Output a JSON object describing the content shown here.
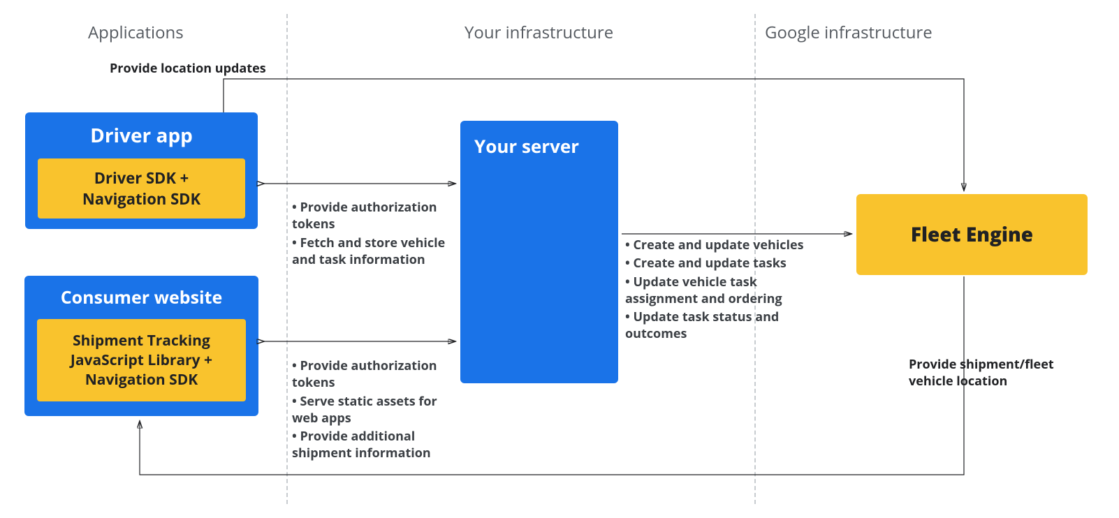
{
  "sections": {
    "applications": "Applications",
    "your_infra": "Your infrastructure",
    "google_infra": "Google infrastructure"
  },
  "driver_app": {
    "title": "Driver app",
    "inner": "Driver SDK +\nNavigation SDK"
  },
  "consumer_website": {
    "title": "Consumer website",
    "inner": "Shipment Tracking\nJavaScript Library  +\nNavigation SDK"
  },
  "your_server": {
    "title": "Your server"
  },
  "fleet_engine": {
    "title": "Fleet Engine"
  },
  "edge_labels": {
    "top": "Provide location updates",
    "bottom_right": "Provide shipment/fleet\nvehicle location"
  },
  "annotations": {
    "driver_to_server": [
      "• Provide authorization tokens",
      "• Fetch and store vehicle and task information"
    ],
    "consumer_to_server": [
      "• Provide authorization tokens",
      "• Serve static assets for web apps",
      "• Provide additional shipment information"
    ],
    "server_to_fleet": [
      "• Create and update vehicles",
      "• Create and update tasks",
      "• Update vehicle task assignment and ordering",
      "• Update task status and outcomes"
    ]
  }
}
